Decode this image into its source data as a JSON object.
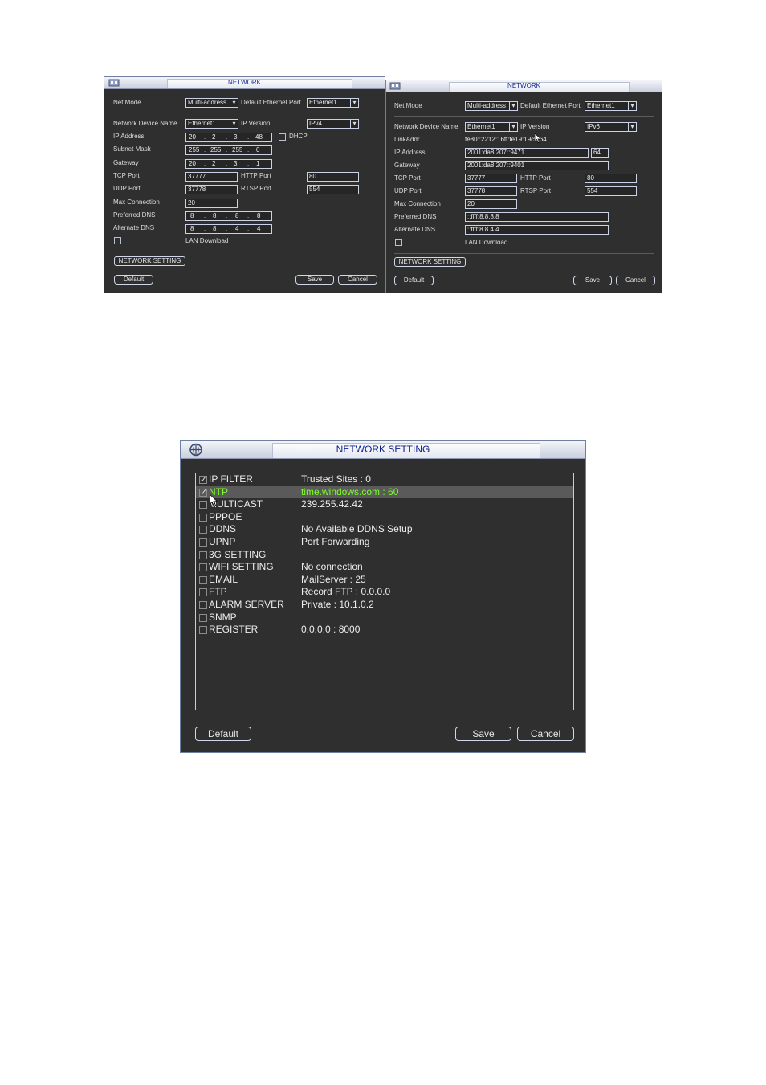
{
  "ipv4_window": {
    "title": "NETWORK",
    "net_mode_label": "Net Mode",
    "net_mode_value": "Multi-address",
    "default_eth_label": "Default Ethernet Port",
    "default_eth_value": "Ethernet1",
    "device_name_label": "Network Device Name",
    "device_name_value": "Ethernet1",
    "ip_version_label": "IP Version",
    "ip_version_value": "IPv4",
    "ip_address_label": "IP Address",
    "ip_address": [
      "20",
      "2",
      "3",
      "48"
    ],
    "dhcp_label": "DHCP",
    "subnet_label": "Subnet Mask",
    "subnet": [
      "255",
      "255",
      "255",
      "0"
    ],
    "gateway_label": "Gateway",
    "gateway": [
      "20",
      "2",
      "3",
      "1"
    ],
    "tcp_label": "TCP Port",
    "tcp_value": "37777",
    "http_label": "HTTP Port",
    "http_value": "80",
    "udp_label": "UDP Port",
    "udp_value": "37778",
    "rtsp_label": "RTSP Port",
    "rtsp_value": "554",
    "max_conn_label": "Max Connection",
    "max_conn_value": "20",
    "pref_dns_label": "Preferred DNS",
    "pref_dns": [
      "8",
      "8",
      "8",
      "8"
    ],
    "alt_dns_label": "Alternate DNS",
    "alt_dns": [
      "8",
      "8",
      "4",
      "4"
    ],
    "lan_download_label": "LAN Download",
    "network_setting_button": "NETWORK SETTING",
    "default_button": "Default",
    "save_button": "Save",
    "cancel_button": "Cancel"
  },
  "ipv6_window": {
    "title": "NETWORK",
    "net_mode_label": "Net Mode",
    "net_mode_value": "Multi-address",
    "default_eth_label": "Default Ethernet Port",
    "default_eth_value": "Ethernet1",
    "device_name_label": "Network Device Name",
    "device_name_value": "Ethernet1",
    "ip_version_label": "IP Version",
    "ip_version_value": "IPv6",
    "linkaddr_label": "LinkAddr",
    "linkaddr_value": "fe80::2212:16ff:fe19:19c9/64",
    "ip_address_label": "IP Address",
    "ip_address_value": "2001:da8:207::9471",
    "prefix_value": "64",
    "gateway_label": "Gateway",
    "gateway_value": "2001:da8:207::9401",
    "tcp_label": "TCP Port",
    "tcp_value": "37777",
    "http_label": "HTTP Port",
    "http_value": "80",
    "udp_label": "UDP Port",
    "udp_value": "37778",
    "rtsp_label": "RTSP Port",
    "rtsp_value": "554",
    "max_conn_label": "Max Connection",
    "max_conn_value": "20",
    "pref_dns_label": "Preferred DNS",
    "pref_dns_value": "::ffff:8.8.8.8",
    "alt_dns_label": "Alternate DNS",
    "alt_dns_value": "::ffff:8.8.4.4",
    "lan_download_label": "LAN Download",
    "network_setting_button": "NETWORK SETTING",
    "default_button": "Default",
    "save_button": "Save",
    "cancel_button": "Cancel"
  },
  "network_setting_window": {
    "title": "NETWORK SETTING",
    "items": [
      {
        "name": "IP FILTER",
        "value": "Trusted Sites : 0",
        "checked": true
      },
      {
        "name": "NTP",
        "value": "time.windows.com : 60",
        "checked": true,
        "selected": true
      },
      {
        "name": "MULTICAST",
        "value": "239.255.42.42",
        "checked": false
      },
      {
        "name": "PPPOE",
        "value": "",
        "checked": false
      },
      {
        "name": "DDNS",
        "value": "No Available DDNS Setup",
        "checked": false
      },
      {
        "name": "UPNP",
        "value": "Port Forwarding",
        "checked": false
      },
      {
        "name": "3G SETTING",
        "value": "",
        "checked": false
      },
      {
        "name": "WIFI SETTING",
        "value": "No connection",
        "checked": false
      },
      {
        "name": "EMAIL",
        "value": "MailServer : 25",
        "checked": false
      },
      {
        "name": "FTP",
        "value": "Record FTP : 0.0.0.0",
        "checked": false
      },
      {
        "name": "ALARM SERVER",
        "value": "Private : 10.1.0.2",
        "checked": false
      },
      {
        "name": "SNMP",
        "value": "",
        "checked": false
      },
      {
        "name": "REGISTER",
        "value": "0.0.0.0 : 8000",
        "checked": false
      }
    ],
    "default_button": "Default",
    "save_button": "Save",
    "cancel_button": "Cancel"
  },
  "icons": {
    "window_icon": "network-app-icon",
    "check": "checkmark-icon",
    "dropdown": "dropdown-arrow-icon",
    "cursor": "mouse-cursor-icon"
  },
  "colors": {
    "panel_bg": "#2f2f2f",
    "title_text": "#0b1e8e",
    "selected_text": "#7cfc2a",
    "list_border": "#9fe0e8"
  }
}
